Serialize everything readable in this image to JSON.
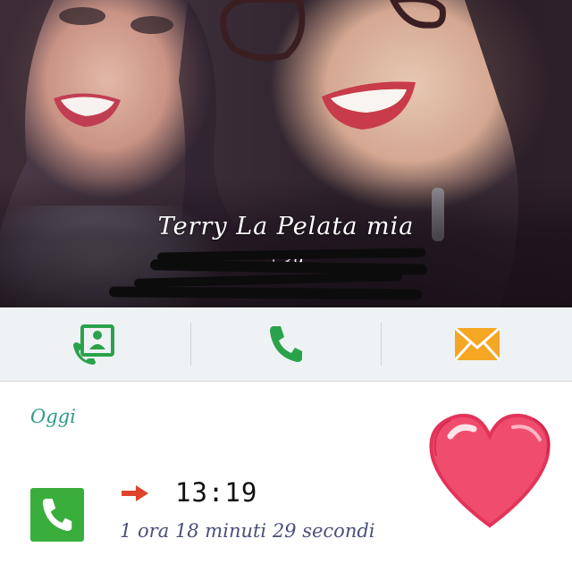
{
  "contact": {
    "name": "Terry La Pelata mia",
    "number_visible": "+39",
    "photo_icon": "contact-photo"
  },
  "actions": [
    {
      "name": "contact-card-icon",
      "color": "#2aa24a"
    },
    {
      "name": "phone-icon",
      "color": "#2aa24a"
    },
    {
      "name": "envelope-icon",
      "color": "#f5a623"
    }
  ],
  "history": {
    "section_label": "Oggi",
    "entries": [
      {
        "type_icon": "phone-icon",
        "direction_icon": "outgoing-arrow-icon",
        "direction_color": "#e0432c",
        "time": "13:19",
        "duration": "1 ora 18 minuti 29 secondi"
      }
    ]
  },
  "decoration": {
    "sticker": "heart-sticker",
    "color": "#f04d6e"
  }
}
